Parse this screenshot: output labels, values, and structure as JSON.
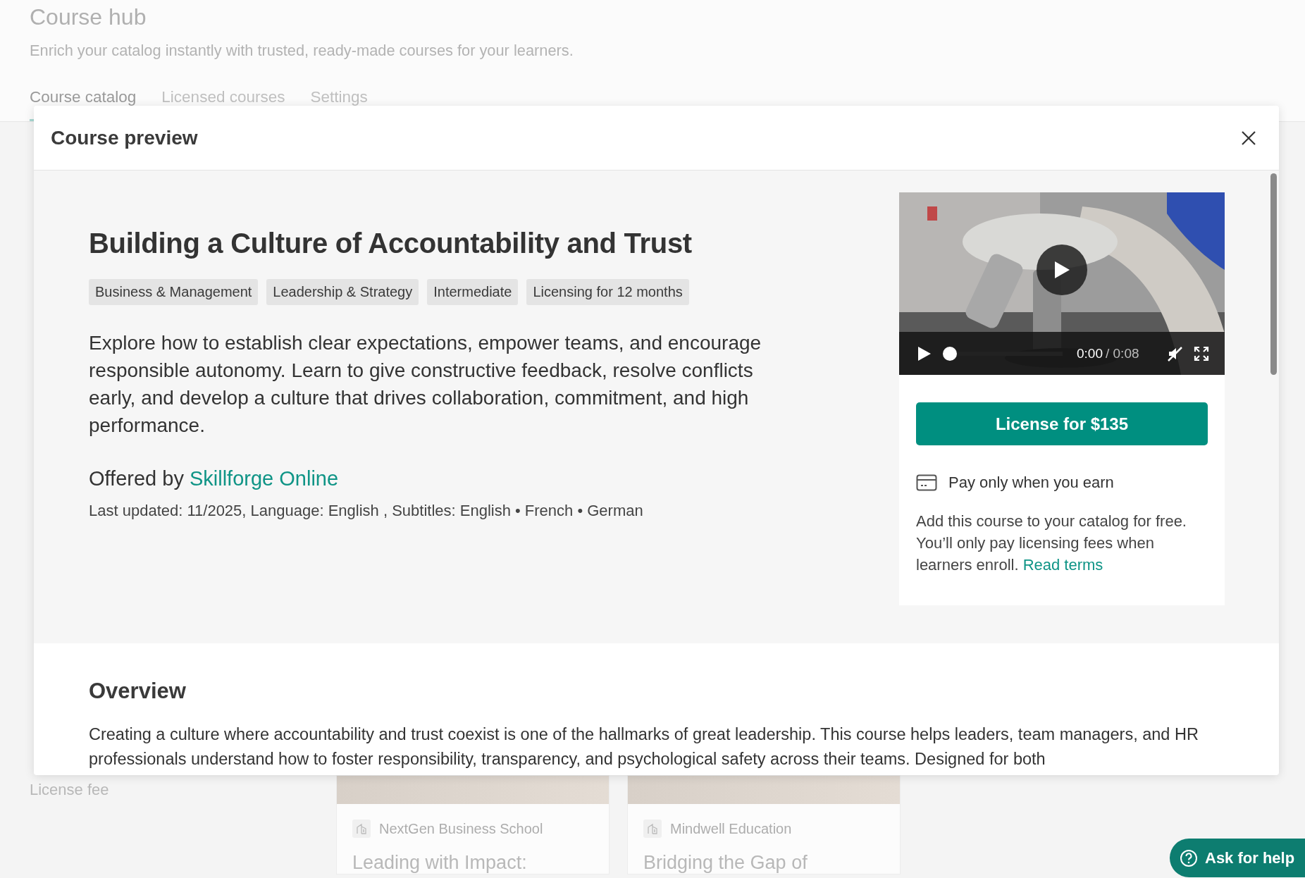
{
  "page": {
    "title": "Course hub",
    "subtitle": "Enrich your catalog instantly with trusted, ready-made courses for your learners.",
    "tabs": [
      {
        "label": "Course catalog",
        "selected": true
      },
      {
        "label": "Licensed courses",
        "selected": false
      },
      {
        "label": "Settings",
        "selected": false
      }
    ],
    "filter_label": "License fee",
    "cards": [
      {
        "provider": "NextGen Business School",
        "title": "Leading with Impact:"
      },
      {
        "provider": "Mindwell Education",
        "title": "Bridging the Gap of"
      }
    ]
  },
  "modal": {
    "title": "Course preview",
    "course": {
      "title": "Building a Culture of Accountability and Trust",
      "tags": [
        "Business & Management",
        "Leadership & Strategy",
        "Intermediate",
        "Licensing for 12 months"
      ],
      "description": "Explore how to establish clear expectations, empower teams, and encourage responsible autonomy. Learn to give constructive feedback, resolve conflicts early, and develop a culture that drives collaboration, commitment, and high performance.",
      "offered_by": "Offered by",
      "provider": "Skillforge Online",
      "meta": "Last updated: 11/2025, Language: English , Subtitles: English • French • German"
    },
    "video": {
      "current_time": "0:00",
      "duration": "/ 0:08",
      "level": 0
    },
    "license_button": "License for $135",
    "pay_note": {
      "title": "Pay only when you earn",
      "text": "Add this course to your catalog for free. You’ll only pay licensing fees when learners enroll.",
      "link": "Read terms"
    },
    "overview": {
      "heading": "Overview",
      "text": "Creating a culture where accountability and trust coexist is one of the hallmarks of great leadership. This course helps leaders, team managers, and HR professionals understand how to foster responsibility, transparency, and psychological safety across their teams. Designed for both"
    }
  },
  "help_button": "Ask for help"
}
